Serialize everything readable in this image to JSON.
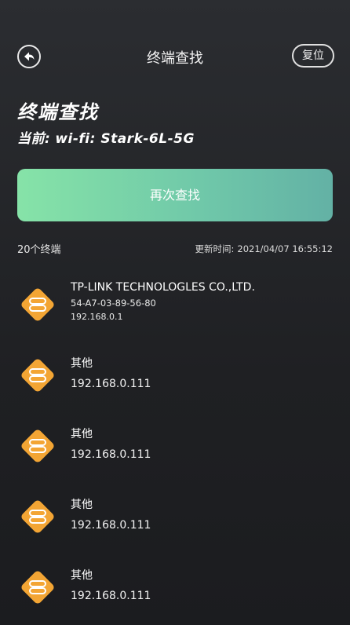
{
  "nav": {
    "title": "终端查找",
    "reset_label": "复位"
  },
  "heading": "终端查找",
  "current": {
    "prefix": "当前:",
    "ssid": "wi-fi: Stark-6L-5G"
  },
  "search_button": "再次查找",
  "count_text": "20个终端",
  "updated": {
    "label": "更新时间:",
    "value": "2021/04/07 16:55:12"
  },
  "devices": [
    {
      "name": "TP-LINK TECHNOLOGLES CO.,LTD.",
      "mac": "54-A7-03-89-56-80",
      "ip": "192.168.0.1",
      "icon": "device-icon"
    },
    {
      "name": "其他",
      "ip": "192.168.0.111",
      "icon": "device-icon"
    },
    {
      "name": "其他",
      "ip": "192.168.0.111",
      "icon": "device-icon"
    },
    {
      "name": "其他",
      "ip": "192.168.0.111",
      "icon": "device-icon"
    },
    {
      "name": "其他",
      "ip": "192.168.0.111",
      "icon": "device-icon"
    }
  ],
  "colors": {
    "accent_start": "#86e3a8",
    "accent_end": "#63b1a5",
    "icon_orange": "#f3a534"
  }
}
